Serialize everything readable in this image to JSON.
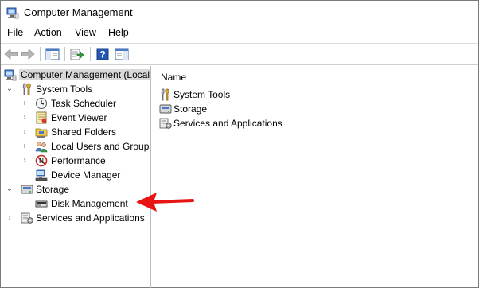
{
  "window": {
    "title": "Computer Management"
  },
  "menu": {
    "items": [
      "File",
      "Action",
      "View",
      "Help"
    ]
  },
  "tree": {
    "root": "Computer Management (Local",
    "items": [
      {
        "label": "System Tools",
        "indent": 1,
        "exp": "v",
        "icon": "tools-icon"
      },
      {
        "label": "Task Scheduler",
        "indent": 2,
        "exp": ">",
        "icon": "clock-icon"
      },
      {
        "label": "Event Viewer",
        "indent": 2,
        "exp": ">",
        "icon": "event-viewer-icon"
      },
      {
        "label": "Shared Folders",
        "indent": 2,
        "exp": ">",
        "icon": "shared-folders-icon"
      },
      {
        "label": "Local Users and Groups",
        "indent": 2,
        "exp": ">",
        "icon": "users-icon"
      },
      {
        "label": "Performance",
        "indent": 2,
        "exp": ">",
        "icon": "performance-icon"
      },
      {
        "label": "Device Manager",
        "indent": 2,
        "exp": "",
        "icon": "device-manager-icon"
      },
      {
        "label": "Storage",
        "indent": 1,
        "exp": "v",
        "icon": "storage-icon"
      },
      {
        "label": "Disk Management",
        "indent": 2,
        "exp": "",
        "icon": "disk-icon"
      },
      {
        "label": "Services and Applications",
        "indent": 1,
        "exp": ">",
        "icon": "services-icon"
      }
    ]
  },
  "list": {
    "header": "Name",
    "items": [
      "System Tools",
      "Storage",
      "Services and Applications"
    ]
  },
  "colors": {
    "arrow": "#e81414",
    "selection": "#d9d9d9",
    "accent": "#2b6cc4"
  }
}
